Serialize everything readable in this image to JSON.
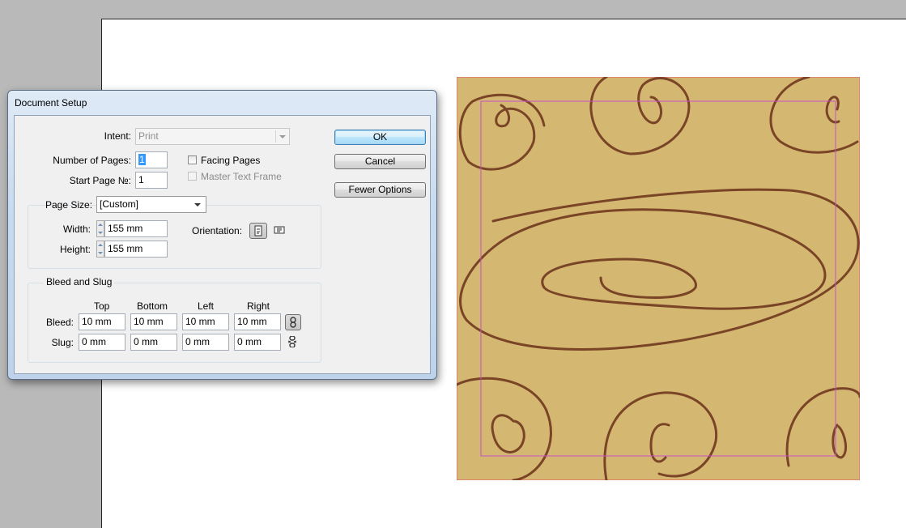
{
  "dialog": {
    "title": "Document Setup",
    "intent": {
      "label": "Intent:",
      "value": "Print"
    },
    "number_of_pages": {
      "label": "Number of Pages:",
      "value": "1"
    },
    "start_page": {
      "label": "Start Page №:",
      "value": "1"
    },
    "facing_pages": {
      "label": "Facing Pages",
      "checked": false
    },
    "master_text_frame": {
      "label": "Master Text Frame",
      "checked": false,
      "enabled": false
    },
    "page_size": {
      "label": "Page Size:",
      "value": "[Custom]",
      "width": {
        "label": "Width:",
        "value": "155 mm"
      },
      "height": {
        "label": "Height:",
        "value": "155 mm"
      },
      "orientation": {
        "label": "Orientation:",
        "selected": "portrait"
      }
    },
    "bleed_and_slug": {
      "title": "Bleed and Slug",
      "columns": [
        "Top",
        "Bottom",
        "Left",
        "Right"
      ],
      "bleed": {
        "label": "Bleed:",
        "values": [
          "10 mm",
          "10 mm",
          "10 mm",
          "10 mm"
        ]
      },
      "slug": {
        "label": "Slug:",
        "values": [
          "0 mm",
          "0 mm",
          "0 mm",
          "0 mm"
        ]
      }
    },
    "buttons": {
      "ok": "OK",
      "cancel": "Cancel",
      "fewer_options": "Fewer Options"
    }
  },
  "colors": {
    "pasteboard": "#b9b9b9",
    "page": "#ffffff",
    "artwork_fill": "#d4b872",
    "artwork_stroke": "#7a4426",
    "guide": "#c84fc8",
    "bleed_guide": "#e0566a"
  },
  "icons": [
    "portrait-orientation-icon",
    "landscape-orientation-icon",
    "chain-link-icon",
    "chain-broken-icon"
  ]
}
